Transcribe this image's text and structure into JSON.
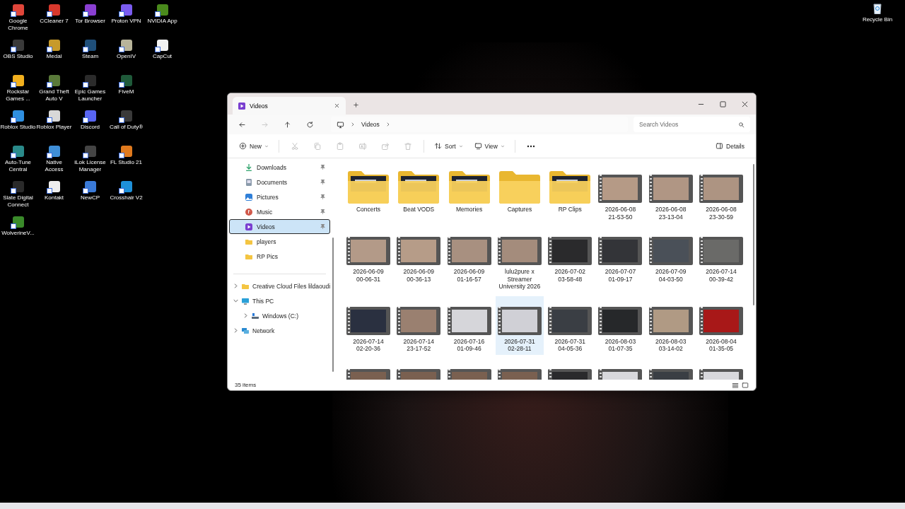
{
  "desktop": {
    "rows": [
      [
        {
          "label": "Google Chrome",
          "color": "#e0463a"
        },
        {
          "label": "CCleaner 7",
          "color": "#d8382c"
        },
        {
          "label": "Tor Browser",
          "color": "#8a3fd1"
        },
        {
          "label": "Proton VPN",
          "color": "#7b5cf0"
        },
        {
          "label": "NVIDIA App",
          "color": "#4a8a1c"
        }
      ],
      [
        {
          "label": "OBS Studio",
          "color": "#3a3a3a"
        },
        {
          "label": "Medal",
          "color": "#c79a2a"
        },
        {
          "label": "Steam",
          "color": "#1f4f7a"
        },
        {
          "label": "OpenIV",
          "color": "#b8b49a"
        },
        {
          "label": "CapCut",
          "color": "#f2f2f2"
        }
      ],
      [
        {
          "label": "Rockstar Games ...",
          "color": "#f2b01e"
        },
        {
          "label": "Grand Theft Auto V",
          "color": "#5a7a3a"
        },
        {
          "label": "Epic Games Launcher",
          "color": "#2b2b2b"
        },
        {
          "label": "FiveM",
          "color": "#1f5a3a"
        }
      ],
      [
        {
          "label": "Roblox Studio",
          "color": "#2f8fe0"
        },
        {
          "label": "Roblox Player",
          "color": "#d8d8d8"
        },
        {
          "label": "Discord",
          "color": "#5865f2"
        },
        {
          "label": "Call of Duty®",
          "color": "#3a3a3a"
        }
      ],
      [
        {
          "label": "Auto-Tune Central",
          "color": "#2a8a8a"
        },
        {
          "label": "Native Access",
          "color": "#3f8fd8"
        },
        {
          "label": "iLok License Manager",
          "color": "#444444"
        },
        {
          "label": "FL Studio 21",
          "color": "#e07a1e"
        }
      ],
      [
        {
          "label": "Slate Digital Connect",
          "color": "#2a2a2a"
        },
        {
          "label": "Kontakt",
          "color": "#eeeeee"
        },
        {
          "label": "NewCP",
          "color": "#3a7ad8"
        },
        {
          "label": "Crosshair V2",
          "color": "#1e90d8"
        }
      ],
      [
        {
          "label": "WolverineV...",
          "color": "#3a8a2a"
        }
      ]
    ],
    "recycle_bin": {
      "label": "Recycle Bin"
    }
  },
  "window": {
    "tab": {
      "title": "Videos"
    },
    "nav": [
      {
        "kind": "back",
        "disabled": false
      },
      {
        "kind": "forward",
        "disabled": true
      },
      {
        "kind": "up",
        "disabled": false
      },
      {
        "kind": "refresh",
        "disabled": false
      }
    ],
    "address": {
      "crumbs": [
        "Videos"
      ]
    },
    "search": {
      "placeholder": "Search Videos"
    },
    "toolbar": {
      "new": "New",
      "actions": [
        {
          "kind": "cut",
          "disabled": true
        },
        {
          "kind": "copy",
          "disabled": true
        },
        {
          "kind": "paste",
          "disabled": true
        },
        {
          "kind": "rename",
          "disabled": true
        },
        {
          "kind": "share",
          "disabled": true
        },
        {
          "kind": "delete",
          "disabled": true
        }
      ],
      "sort": "Sort",
      "view": "View",
      "details": "Details"
    },
    "sidebar": {
      "quick_access": [
        {
          "label": "Downloads",
          "kind": "download",
          "color": "#2ea36b",
          "pinned": true,
          "selected": false
        },
        {
          "label": "Documents",
          "kind": "document",
          "color": "#8a9aaa",
          "pinned": true,
          "selected": false
        },
        {
          "label": "Pictures",
          "kind": "picture",
          "color": "#2f7fd8",
          "pinned": true,
          "selected": false
        },
        {
          "label": "Music",
          "kind": "music",
          "color": "#d0584a",
          "pinned": true,
          "selected": false
        },
        {
          "label": "Videos",
          "kind": "video",
          "color": "#7a3fd0",
          "pinned": true,
          "selected": true
        },
        {
          "label": "players",
          "kind": "folder",
          "color": "#f4c542",
          "pinned": false,
          "selected": false
        },
        {
          "label": "RP Pics",
          "kind": "folder",
          "color": "#f4c542",
          "pinned": false,
          "selected": false
        }
      ],
      "tree": [
        {
          "label": "Creative Cloud Files  lildaoudi",
          "kind": "folder",
          "color": "#f4c542",
          "expanded": false
        },
        {
          "label": "This PC",
          "kind": "pc",
          "color": "#2aa0d8",
          "expanded": true,
          "children": [
            {
              "label": "Windows (C:)",
              "kind": "drive",
              "color": "#5a6a7a",
              "expanded": false
            }
          ]
        },
        {
          "label": "Network",
          "kind": "network",
          "color": "#2a8ad0",
          "expanded": false
        }
      ]
    },
    "items": [
      {
        "kind": "folder",
        "name": "Concerts",
        "preview": true,
        "selected": false
      },
      {
        "kind": "folder",
        "name": "Beat VODS",
        "preview": true,
        "selected": false
      },
      {
        "kind": "folder",
        "name": "Memories",
        "preview": true,
        "selected": false
      },
      {
        "kind": "folder",
        "name": "Captures",
        "preview": false,
        "selected": false
      },
      {
        "kind": "folder",
        "name": "RP Clips",
        "preview": true,
        "selected": false
      },
      {
        "kind": "video",
        "name": "2026-06-08 21-53-50",
        "color": "#b59a86",
        "selected": false
      },
      {
        "kind": "video",
        "name": "2026-06-08 23-13-04",
        "color": "#b09684",
        "selected": false
      },
      {
        "kind": "video",
        "name": "2026-06-08 23-30-59",
        "color": "#ad9482",
        "selected": false
      },
      {
        "kind": "video",
        "name": "2026-06-09 00-06-31",
        "color": "#b39a88",
        "selected": false
      },
      {
        "kind": "video",
        "name": "2026-06-09 00-36-13",
        "color": "#b69c88",
        "selected": false
      },
      {
        "kind": "video",
        "name": "2026-06-09 01-16-57",
        "color": "#a89080",
        "selected": false
      },
      {
        "kind": "video",
        "name": "lulu2pure x Streamer University 2026",
        "color": "#a48c7c",
        "selected": false
      },
      {
        "kind": "video",
        "name": "2026-07-02 03-58-48",
        "color": "#2a2a2c",
        "selected": false
      },
      {
        "kind": "video",
        "name": "2026-07-07 01-09-17",
        "color": "#333438",
        "selected": false
      },
      {
        "kind": "video",
        "name": "2026-07-09 04-03-50",
        "color": "#4a5058",
        "selected": false
      },
      {
        "kind": "video",
        "name": "2026-07-14 00-39-42",
        "color": "#6a6a68",
        "selected": false
      },
      {
        "kind": "video",
        "name": "2026-07-14 02-20-36",
        "color": "#2a3040",
        "selected": false
      },
      {
        "kind": "video",
        "name": "2026-07-14 23-17-52",
        "color": "#9a8070",
        "selected": false
      },
      {
        "kind": "video",
        "name": "2026-07-16 01-09-46",
        "color": "#d6d6da",
        "selected": false
      },
      {
        "kind": "video",
        "name": "2026-07-31 02-28-11",
        "color": "#d0d0d6",
        "selected": true
      },
      {
        "kind": "video",
        "name": "2026-07-31 04-05-36",
        "color": "#3a3e44",
        "selected": false
      },
      {
        "kind": "video",
        "name": "2026-08-03 01-07-35",
        "color": "#26282a",
        "selected": false
      },
      {
        "kind": "video",
        "name": "2026-08-03 03-14-02",
        "color": "#b09a84",
        "selected": false
      },
      {
        "kind": "video",
        "name": "2026-08-04 01-35-05",
        "color": "#a81818",
        "selected": false
      },
      {
        "kind": "video",
        "color": "#7a6050",
        "selected": false
      },
      {
        "kind": "video",
        "color": "#7a6050",
        "selected": false
      },
      {
        "kind": "video",
        "color": "#7a6050",
        "selected": false
      },
      {
        "kind": "video",
        "color": "#7a6050",
        "selected": false
      },
      {
        "kind": "video",
        "color": "#2a2a2c",
        "selected": false
      },
      {
        "kind": "video",
        "color": "#d8d8dc",
        "selected": false
      },
      {
        "kind": "video",
        "color": "#3a3e44",
        "selected": false
      },
      {
        "kind": "video",
        "color": "#d8d8dc",
        "selected": false
      }
    ],
    "status_bar": {
      "count": "35 items"
    }
  }
}
